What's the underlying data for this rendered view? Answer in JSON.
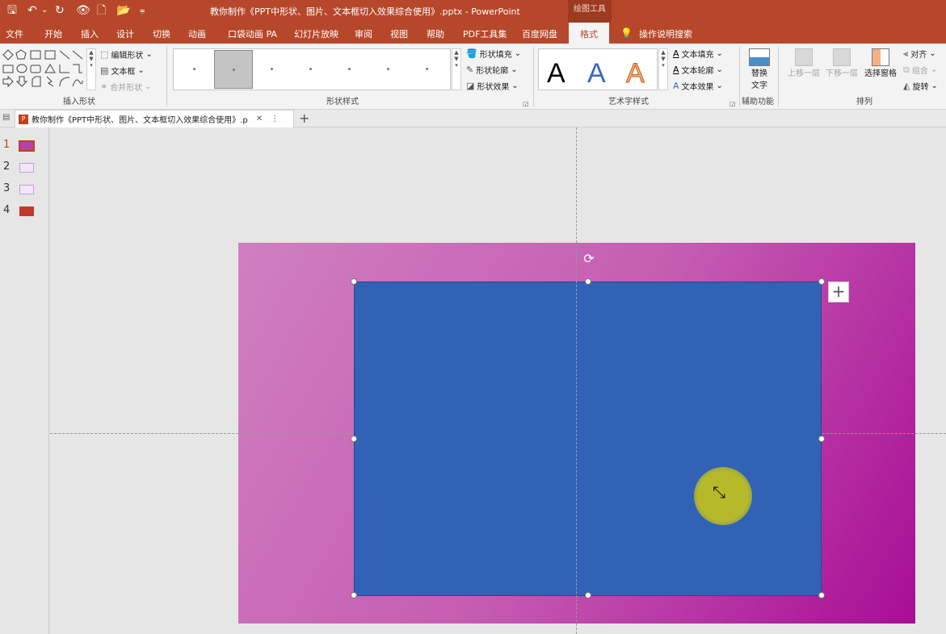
{
  "title": "教你制作《PPT中形状、图片、文本框切入效果综合使用》.pptx  -  PowerPoint",
  "context_tool": "绘图工具",
  "quick_access": {
    "save": "🖫",
    "undo": "↶",
    "undo_more": "⌄",
    "redo": "↻",
    "preview": "👁",
    "new": "🗋",
    "open": "📂",
    "customize": "⩦"
  },
  "tabs": [
    "文件",
    "开始",
    "插入",
    "设计",
    "切换",
    "动画",
    "口袋动画 PA",
    "幻灯片放映",
    "审阅",
    "视图",
    "帮助",
    "PDF工具集",
    "百度网盘",
    "格式"
  ],
  "active_tab": "格式",
  "search": {
    "icon": "lightbulb-icon",
    "label": "操作说明搜索"
  },
  "ribbon": {
    "insert_shapes": {
      "label": "插入形状",
      "edit_shape": "编辑形状",
      "text_box": "文本框",
      "merge_shapes": "合并形状"
    },
    "shape_styles": {
      "label": "形状样式",
      "fill": "形状填充",
      "outline": "形状轮廓",
      "effects": "形状效果"
    },
    "wordart": {
      "label": "艺术字样式",
      "samples": [
        "A",
        "A",
        "A"
      ],
      "text_fill": "文本填充",
      "text_outline": "文本轮廓",
      "text_effects": "文本效果"
    },
    "accessibility": {
      "label": "辅助功能",
      "alt_text_line1": "替换",
      "alt_text_line2": "文字"
    },
    "arrange": {
      "label": "排列",
      "bring_forward": "上移一层",
      "send_backward": "下移一层",
      "selection_pane": "选择窗格",
      "align": "对齐",
      "group": "组合",
      "rotate": "旋转"
    }
  },
  "document_tab": {
    "name": "教你制作《PPT中形状、图片、文本框切入效果综合使用》.p",
    "close": "✕",
    "more": "⋮",
    "new": "+"
  },
  "slides": [
    {
      "number": "1",
      "active": true,
      "color": "#b8429e"
    },
    {
      "number": "2",
      "active": false,
      "color": "#c0a0d8"
    },
    {
      "number": "3",
      "active": false,
      "color": "#c0a0d8"
    },
    {
      "number": "4",
      "active": false,
      "color": "#c0392b"
    }
  ],
  "colors": {
    "brand": "#b7472a",
    "shape_fill": "#3162b5",
    "slide_gradient_start": "#d07fc0",
    "slide_gradient_end": "#a80d95",
    "cursor_highlight": "#b6ba2a"
  },
  "canvas": {
    "rotate_glyph": "⟳",
    "plus_glyph": "+",
    "cursor_glyph": "⤡"
  }
}
